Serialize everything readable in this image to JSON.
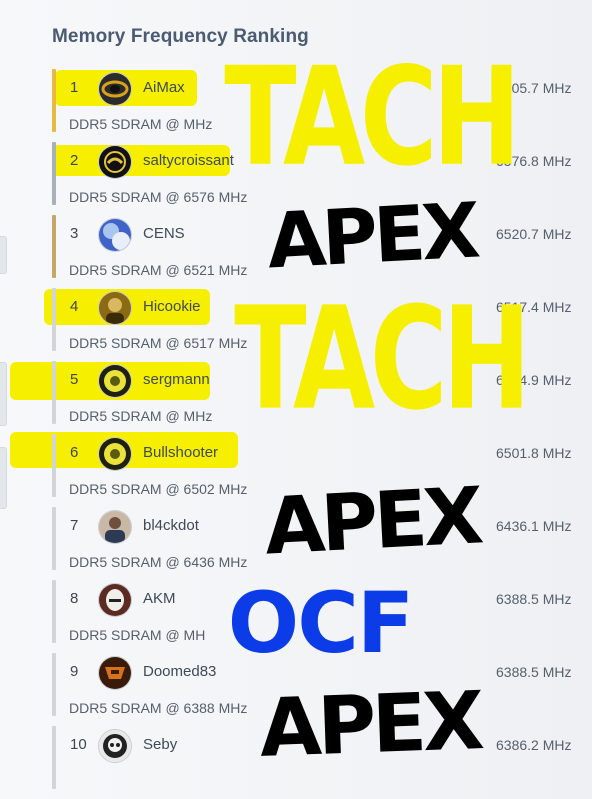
{
  "title": "Memory Frequency Ranking",
  "colors": {
    "gold": "#e6bb45",
    "silver": "#aab0b8",
    "bronze": "#c4a769",
    "default": "#d1d5da",
    "highlight": "#f6ef00",
    "annotation_black": "#000000",
    "annotation_blue": "#0b3ce8"
  },
  "ranking": [
    {
      "rank": "1",
      "name": "AiMax",
      "frequency": "6605.7 MHz",
      "memory": "DDR5 SDRAM @ MHz",
      "avatar": "aimax-logo-avatar",
      "medal": "gold",
      "highlighted": true
    },
    {
      "rank": "2",
      "name": "saltycroissant",
      "frequency": "6576.8 MHz",
      "memory": "DDR5 SDRAM @ 6576 MHz",
      "avatar": "croissant-emblem-avatar",
      "medal": "silver",
      "highlighted": true
    },
    {
      "rank": "3",
      "name": "CENS",
      "frequency": "6520.7 MHz",
      "memory": "DDR5 SDRAM @ 6521 MHz",
      "avatar": "blue-artwork-avatar",
      "medal": "bronze",
      "highlighted": false
    },
    {
      "rank": "4",
      "name": "Hicookie",
      "frequency": "6517.4 MHz",
      "memory": "DDR5 SDRAM @ 6517 MHz",
      "avatar": "portrait-avatar",
      "medal": "default",
      "highlighted": true
    },
    {
      "rank": "5",
      "name": "sergmann",
      "frequency": "6504.9 MHz",
      "memory": "DDR5 SDRAM @ MHz",
      "avatar": "yellow-logo-avatar",
      "medal": "default",
      "highlighted": true
    },
    {
      "rank": "6",
      "name": "Bullshooter",
      "frequency": "6501.8 MHz",
      "memory": "DDR5 SDRAM @ 6502 MHz",
      "avatar": "yellow-logo-avatar",
      "medal": "default",
      "highlighted": true
    },
    {
      "rank": "7",
      "name": "bl4ckdot",
      "frequency": "6436.1 MHz",
      "memory": "DDR5 SDRAM @ 6436 MHz",
      "avatar": "person-photo-avatar",
      "medal": "default",
      "highlighted": false
    },
    {
      "rank": "8",
      "name": "AKM",
      "frequency": "6388.5 MHz",
      "memory": "DDR5 SDRAM @ MH",
      "avatar": "trooper-helmet-avatar",
      "medal": "default",
      "highlighted": false
    },
    {
      "rank": "9",
      "name": "Doomed83",
      "frequency": "6388.5 MHz",
      "memory": "DDR5 SDRAM @ 6388 MHz",
      "avatar": "doom-logo-avatar",
      "medal": "default",
      "highlighted": false
    },
    {
      "rank": "10",
      "name": "Seby",
      "frequency": "6386.2 MHz",
      "memory": "",
      "avatar": "skull-avatar",
      "medal": "default",
      "highlighted": false
    }
  ],
  "annotations": {
    "tach_1": "TACH",
    "apex_1": "APEX",
    "tach_2": "TACH",
    "apex_2": "APEX",
    "ocf": "OCF",
    "apex_3": "APEX"
  }
}
